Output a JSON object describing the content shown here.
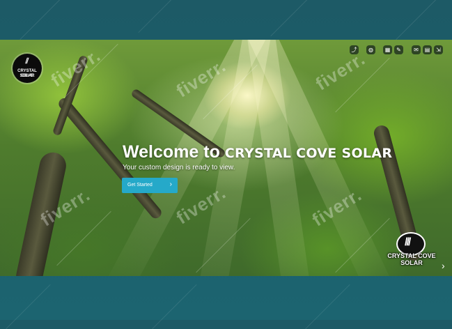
{
  "hero": {
    "welcome_prefix": "Welcome to ",
    "welcome_brand": "CRYSTAL COVE SOLAR",
    "subtitle": "Your custom design is ready to view.",
    "cta_label": "Get Started",
    "cta_chevron": "›"
  },
  "logo_small": {
    "line1": "CRYSTAL COVE",
    "line2": "SOLAR"
  },
  "logo_big": {
    "line1": "CRYSTAL COVE",
    "line2": "SOLAR"
  },
  "watermark_text": "fiverr.",
  "toolbar": [
    {
      "name": "share-icon",
      "glyph": "⤴"
    },
    {
      "name": "globe-icon",
      "glyph": "◍"
    },
    {
      "name": "grid-icon",
      "glyph": "▦"
    },
    {
      "name": "edit-icon",
      "glyph": "✎"
    },
    {
      "name": "mail-icon",
      "glyph": "✉"
    },
    {
      "name": "document-icon",
      "glyph": "▤"
    },
    {
      "name": "export-icon",
      "glyph": "⇲"
    }
  ],
  "next_arrow": "›",
  "colors": {
    "cta": "#25a9c9",
    "frame_bg": "#1a5f6b"
  }
}
